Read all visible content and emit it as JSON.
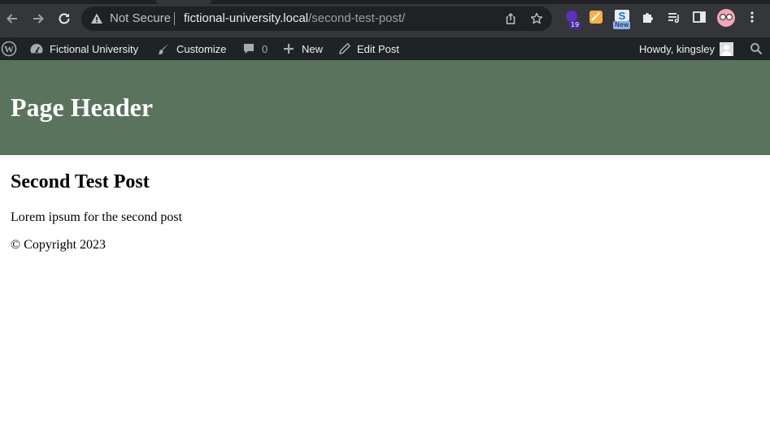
{
  "browser": {
    "security_label": "Not Secure",
    "url_host": "fictional-university.local",
    "url_path": "/second-test-post/",
    "extensions": [
      {
        "icon": "extension-purple-icon",
        "badge": "19"
      },
      {
        "icon": "extension-notes-icon"
      },
      {
        "icon": "extension-s-icon",
        "badge": "New"
      }
    ]
  },
  "admin_bar": {
    "site_name": "Fictional University",
    "customize": "Customize",
    "comments_count": "0",
    "new": "New",
    "edit_post": "Edit Post",
    "howdy": "Howdy, kingsley"
  },
  "page": {
    "header_title": "Page Header",
    "header_color": "#5a735c",
    "post_title": "Second Test Post",
    "post_body": "Lorem ipsum for the second post",
    "footer": "© Copyright 2023"
  }
}
